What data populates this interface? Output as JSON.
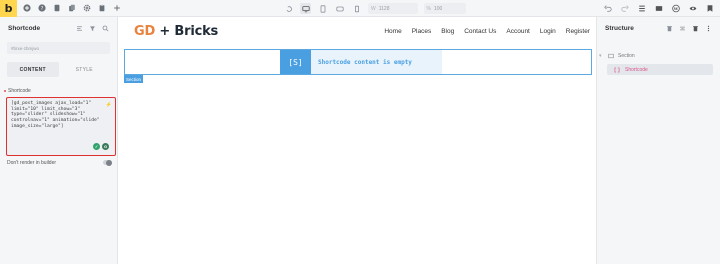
{
  "topbar": {
    "logo": "b",
    "width_label": "W",
    "width_value": "1128",
    "zoom_label": "%",
    "zoom_value": "100",
    "left_icons": [
      "plus-circle-icon",
      "help-icon",
      "pages-icon",
      "copy-icon",
      "settings-icon",
      "clipboard-icon",
      "add-icon"
    ],
    "right_icons": [
      "undo-icon",
      "redo-icon",
      "history-icon",
      "layers-icon",
      "wordpress-icon",
      "preview-icon",
      "save-icon"
    ]
  },
  "left_panel": {
    "title": "Shortcode",
    "id_value": "#brxe-zbmjwo",
    "tab_content": "CONTENT",
    "tab_style": "STYLE",
    "group_label": "Shortcode",
    "shortcode_value": "[gd_post_images ajax_load=\"1\"\nlimit=\"10\" limit_show=\"3\"\ntype=\"slider\" slideshow=\"1\"\ncontrolnav=\"1\" animation=\"slide\"\nimage_size=\"large\"]",
    "dont_render_label": "Don't render in builder"
  },
  "canvas": {
    "brand_gd": "GD",
    "brand_rest": " + Bricks",
    "nav": [
      "Home",
      "Places",
      "Blog",
      "Contact Us",
      "Account",
      "Login",
      "Register"
    ],
    "shortcode_icon_text": "[S]",
    "shortcode_message": "Shortcode content is empty",
    "section_tag": "Section"
  },
  "right_panel": {
    "title": "Structure",
    "tree_section": "Section",
    "tree_shortcode": "Shortcode"
  },
  "colors": {
    "accent_yellow": "#ffd64d",
    "brand_orange": "#e8823c",
    "frame_blue": "#4a9fe0",
    "highlight_red": "#e03131",
    "structure_pink": "#d9558f"
  }
}
